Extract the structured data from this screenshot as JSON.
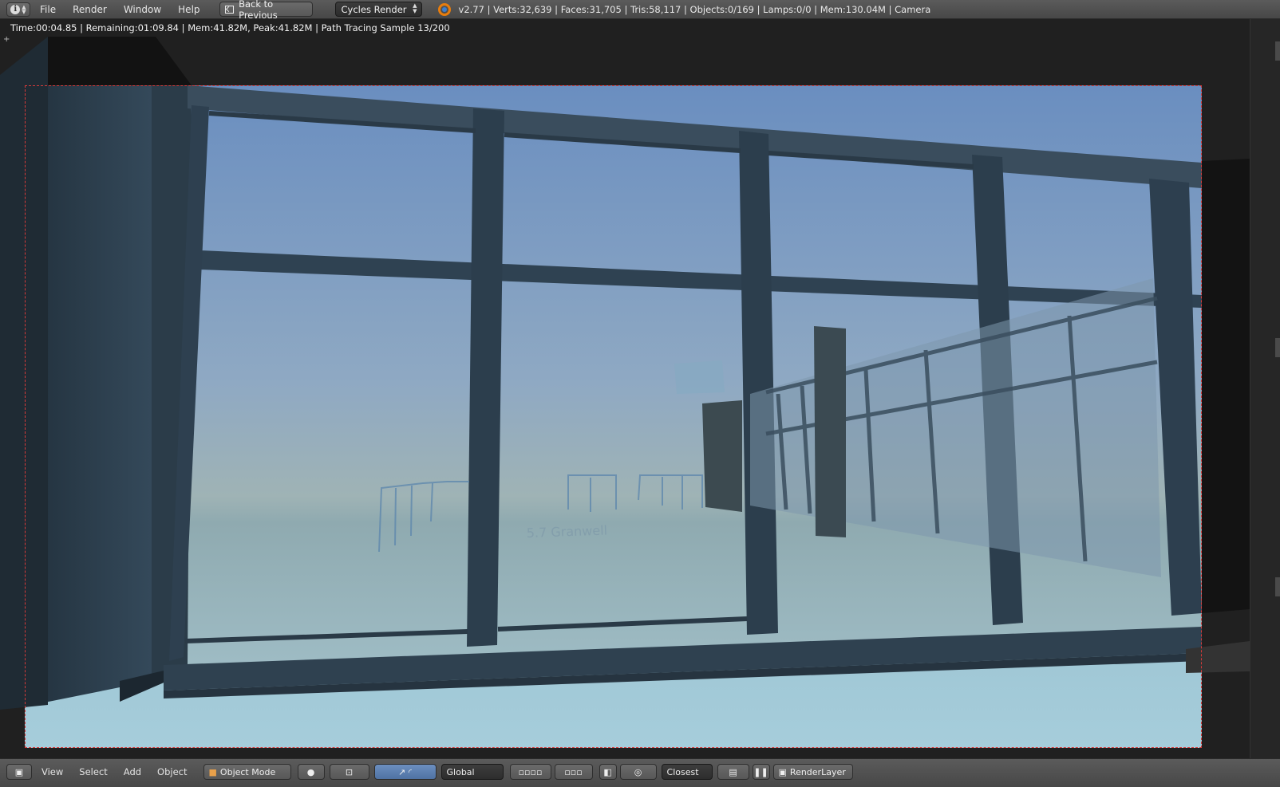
{
  "header": {
    "editor_type_icon": "info-icon",
    "menu": [
      "File",
      "Render",
      "Window",
      "Help"
    ],
    "back_button_label": "Back to Previous",
    "render_engine": "Cycles Render",
    "stats": "v2.77 | Verts:32,639 | Faces:31,705 | Tris:58,117 | Objects:0/169 | Lamps:0/0 | Mem:130.04M | Camera"
  },
  "viewport": {
    "render_status": "Time:00:04.85 | Remaining:01:09.84 | Mem:41.82M, Peak:41.82M | Path Tracing Sample 13/200",
    "floor_text": "5.7 Granwell"
  },
  "footer": {
    "menu": [
      "View",
      "Select",
      "Add",
      "Object"
    ],
    "mode": "Object Mode",
    "orientation": "Global",
    "pivot": "Closest",
    "render_layer": "RenderLayer"
  },
  "colors": {
    "header_bg": "#4f4f4f",
    "viewport_bg": "#222222",
    "camera_border": "#d63a3a",
    "sky_top": "#6a8ec0",
    "floor": "#9cc4d3",
    "frame": "#2f4050"
  }
}
